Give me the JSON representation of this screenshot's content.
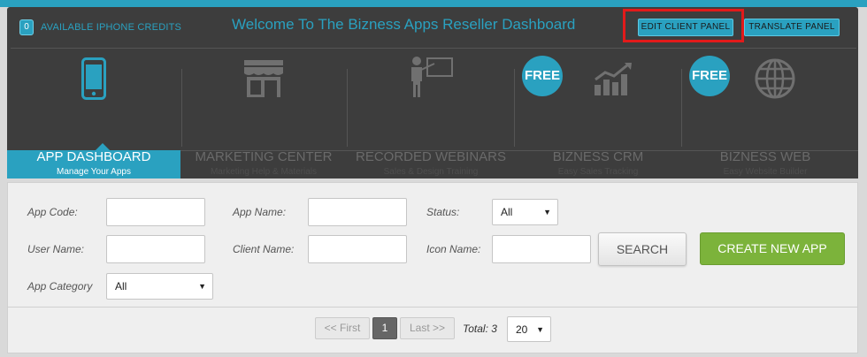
{
  "header": {
    "credits_count": "0",
    "credits_label": "AVAILABLE IPHONE CREDITS",
    "welcome": "Welcome To The Bizness Apps Reseller Dashboard",
    "edit_client_panel": "EDIT CLIENT PANEL",
    "translate_panel": "TRANSLATE PANEL"
  },
  "nav": {
    "free_label": "FREE",
    "items": [
      {
        "title": "APP DASHBOARD",
        "subtitle": "Manage Your Apps",
        "icon": "phone-icon",
        "active": true
      },
      {
        "title": "MARKETING CENTER",
        "subtitle": "Marketing Help & Materials",
        "icon": "storefront-icon"
      },
      {
        "title": "RECORDED WEBINARS",
        "subtitle": "Sales & Design Training",
        "icon": "presenter-icon"
      },
      {
        "title": "BIZNESS CRM",
        "subtitle": "Easy Sales Tracking",
        "icon": "bar-chart-icon",
        "free": true
      },
      {
        "title": "BIZNESS WEB",
        "subtitle": "Easy Website Builder",
        "icon": "globe-icon",
        "free": true
      }
    ]
  },
  "filters": {
    "app_code_label": "App Code:",
    "app_name_label": "App Name:",
    "status_label": "Status:",
    "status_value": "All",
    "user_name_label": "User Name:",
    "client_name_label": "Client Name:",
    "icon_name_label": "Icon Name:",
    "app_category_label": "App Category",
    "app_category_value": "All",
    "search_button": "SEARCH",
    "create_button": "CREATE NEW APP"
  },
  "pagination": {
    "first": "<< First",
    "current_page": "1",
    "last": "Last >>",
    "total": "Total: 3",
    "per_page": "20"
  },
  "colors": {
    "accent": "#2aa1c0",
    "header_bg": "#3d3d3d",
    "create_green": "#7cb33b",
    "highlight_red": "#e21a1a"
  }
}
